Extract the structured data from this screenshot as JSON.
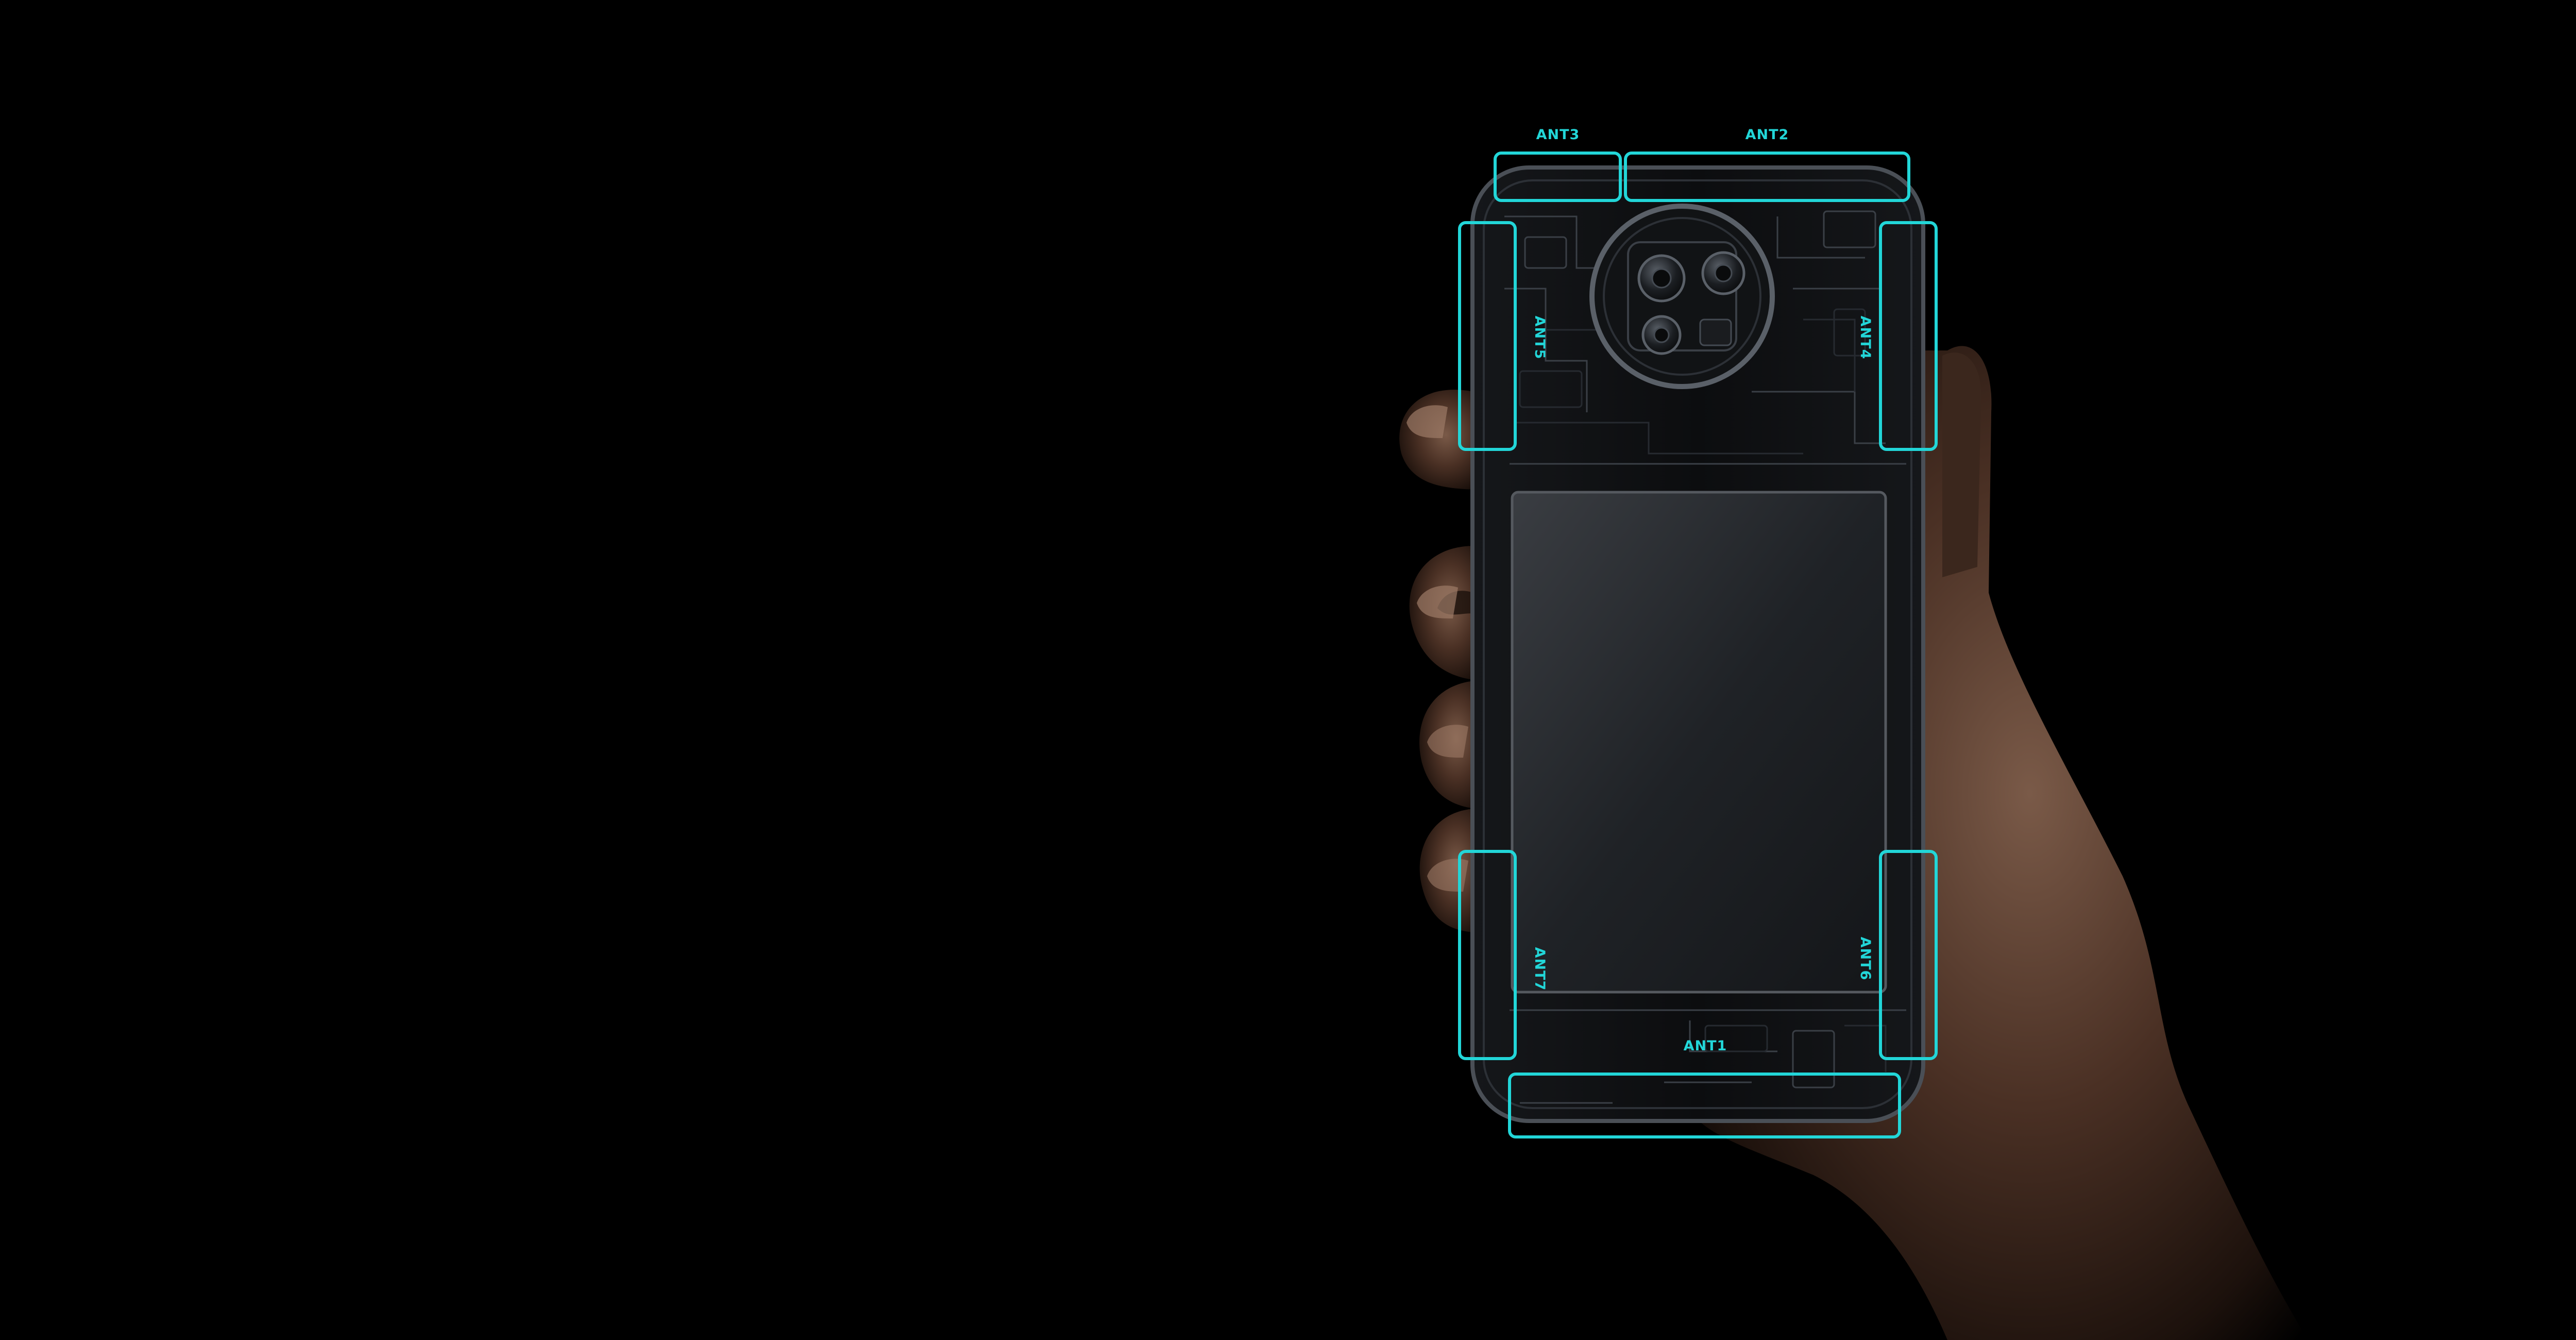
{
  "accent_color": "#22d6d8",
  "background_color": "#000000",
  "antennas": {
    "ant1": "ANT1",
    "ant2": "ANT2",
    "ant3": "ANT3",
    "ant4": "ANT4",
    "ant5": "ANT5",
    "ant6": "ANT6",
    "ant7": "ANT7"
  }
}
